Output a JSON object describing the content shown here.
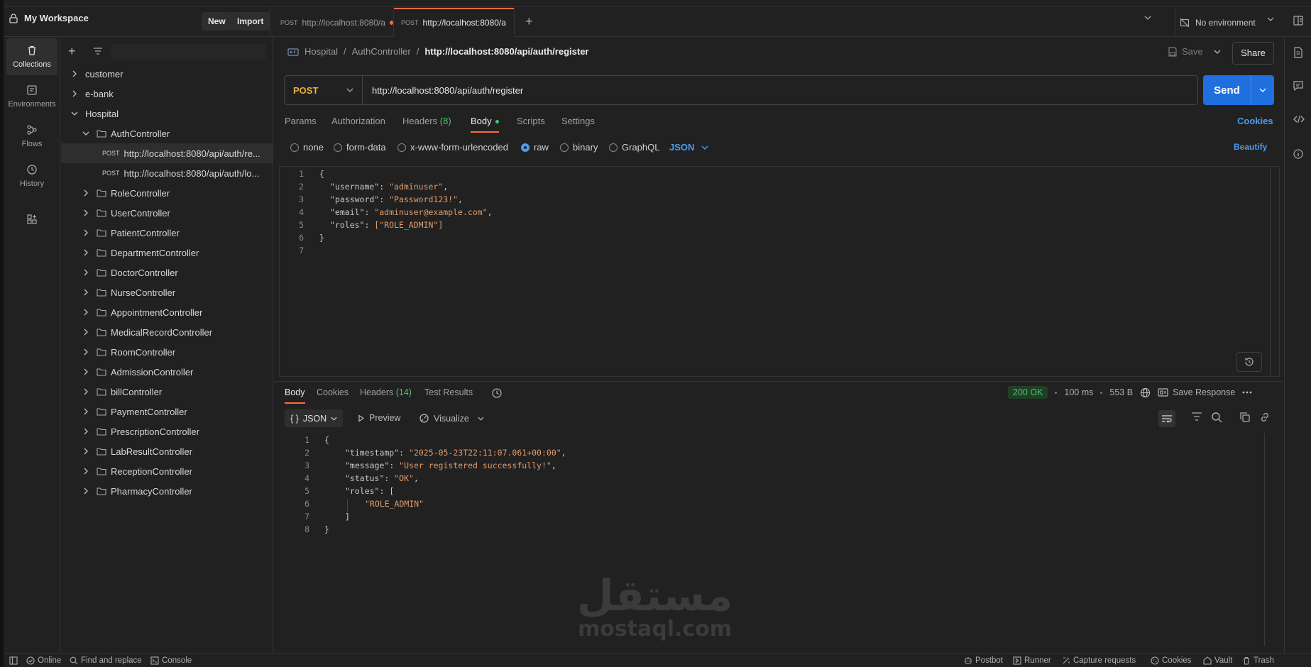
{
  "workspace": {
    "name": "My Workspace",
    "new_label": "New",
    "import_label": "Import"
  },
  "tabs": [
    {
      "method": "POST",
      "label": "http://localhost:8080/a",
      "unsaved": true
    },
    {
      "method": "POST",
      "label": "http://localhost:8080/a",
      "active": true
    }
  ],
  "environment": {
    "label": "No environment"
  },
  "rail": [
    {
      "label": "Collections",
      "icon": "trash-can-icon",
      "active": true
    },
    {
      "label": "Environments",
      "icon": "environment-icon"
    },
    {
      "label": "Flows",
      "icon": "flows-icon"
    },
    {
      "label": "History",
      "icon": "history-icon"
    }
  ],
  "tree": {
    "collections": [
      "customer",
      "e-bank"
    ],
    "hospital": "Hospital",
    "auth_controller": "AuthController",
    "requests": [
      {
        "method": "POST",
        "label": "http://localhost:8080/api/auth/re..."
      },
      {
        "method": "POST",
        "label": "http://localhost:8080/api/auth/lo..."
      }
    ],
    "folders": [
      "RoleController",
      "UserController",
      "PatientController",
      "DepartmentController",
      "DoctorController",
      "NurseController",
      "AppointmentController",
      "MedicalRecordController",
      "RoomController",
      "AdmissionController",
      "billController",
      "PaymentController",
      "PrescriptionController",
      "LabResultController",
      "ReceptionController",
      "PharmacyController"
    ]
  },
  "breadcrumb": {
    "collection": "Hospital",
    "sep": "/",
    "folder": "AuthController",
    "current": "http://localhost:8080/api/auth/register"
  },
  "save_label": "Save",
  "share_label": "Share",
  "request": {
    "method": "POST",
    "url": "http://localhost:8080/api/auth/register",
    "send_label": "Send"
  },
  "request_tabs": {
    "params": "Params",
    "authorization": "Authorization",
    "headers": "Headers",
    "headers_count": "(8)",
    "body": "Body",
    "scripts": "Scripts",
    "settings": "Settings",
    "cookies": "Cookies"
  },
  "body_types": {
    "none": "none",
    "form_data": "form-data",
    "urlencoded": "x-www-form-urlencoded",
    "raw": "raw",
    "binary": "binary",
    "graphql": "GraphQL",
    "language": "JSON",
    "beautify": "Beautify"
  },
  "request_body": {
    "open": "{",
    "close": "}",
    "fields": [
      {
        "key": "\"username\"",
        "value": "\"adminuser\"",
        "tail": ","
      },
      {
        "key": "\"password\"",
        "value": "\"Password123!\"",
        "tail": ","
      },
      {
        "key": "\"email\"",
        "value": "\"adminuser@example.com\"",
        "tail": ","
      },
      {
        "key": "\"roles\"",
        "value": "[\"ROLE_ADMIN\"]",
        "tail": ""
      }
    ]
  },
  "response_tabs": {
    "body": "Body",
    "cookies": "Cookies",
    "headers": "Headers",
    "headers_count": "(14)",
    "test_results": "Test Results"
  },
  "response_status": {
    "code": "200 OK",
    "time": "100 ms",
    "size": "553 B",
    "save_response": "Save Response"
  },
  "response_toolbar": {
    "format": "JSON",
    "format_icon": "{ }",
    "preview": "Preview",
    "visualize": "Visualize"
  },
  "response_body": {
    "open": "{",
    "timestamp_key": "\"timestamp\"",
    "timestamp_val": "\"2025-05-23T22:11:07.061+00:00\"",
    "message_key": "\"message\"",
    "message_val": "\"User registered successfully!\"",
    "status_key": "\"status\"",
    "status_val": "\"OK\"",
    "roles_key": "\"roles\"",
    "roles_open": "[",
    "roles_item": "\"ROLE_ADMIN\"",
    "roles_close": "]",
    "close": "}"
  },
  "watermark": {
    "arabic": "مستقل",
    "latin": "mostaql.com"
  },
  "footer": {
    "online": "Online",
    "find_replace": "Find and replace",
    "console": "Console",
    "postbot": "Postbot",
    "runner": "Runner",
    "capture": "Capture requests",
    "cookies": "Cookies",
    "vault": "Vault",
    "trash": "Trash"
  }
}
